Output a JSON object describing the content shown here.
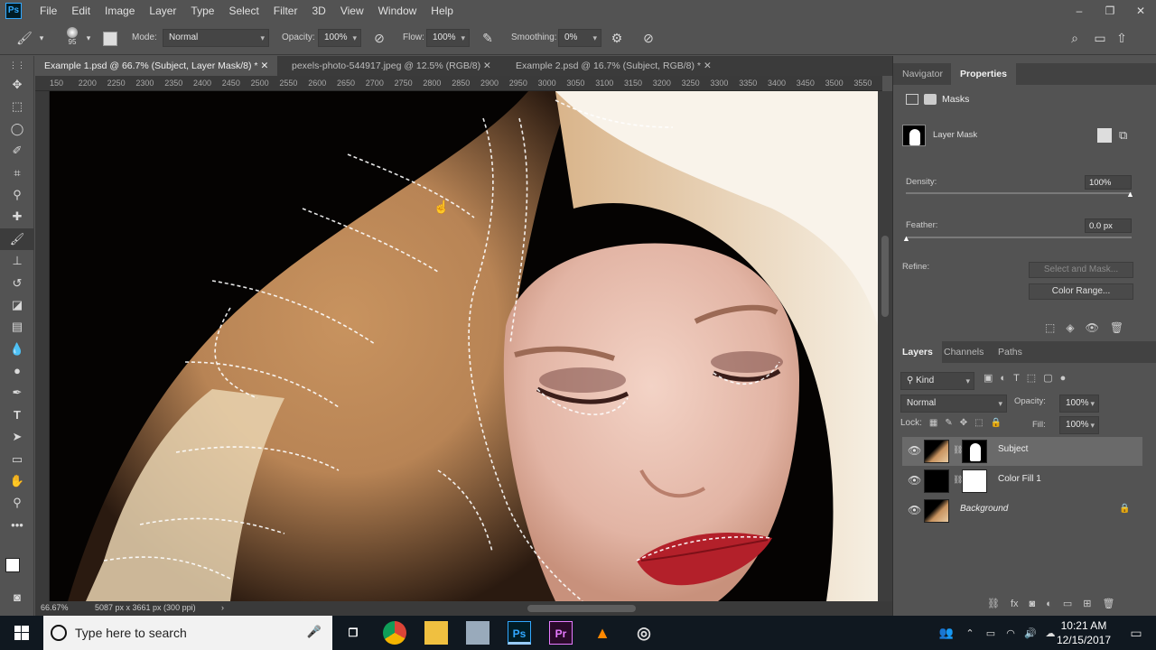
{
  "app": {
    "logo": "Ps"
  },
  "menu": [
    "File",
    "Edit",
    "Image",
    "Layer",
    "Type",
    "Select",
    "Filter",
    "3D",
    "View",
    "Window",
    "Help"
  ],
  "window_controls": [
    "–",
    "❐",
    "✕"
  ],
  "options": {
    "brush_size": "95",
    "mode_label": "Mode:",
    "mode_value": "Normal",
    "opacity_label": "Opacity:",
    "opacity_value": "100%",
    "flow_label": "Flow:",
    "flow_value": "100%",
    "smoothing_label": "Smoothing:",
    "smoothing_value": "0%"
  },
  "tabs": [
    {
      "label": "Example 1.psd @ 66.7% (Subject, Layer Mask/8) *"
    },
    {
      "label": "pexels-photo-544917.jpeg @ 12.5% (RGB/8)"
    },
    {
      "label": "Example 2.psd @ 16.7% (Subject, RGB/8) *"
    }
  ],
  "ruler_ticks": [
    "150",
    "2200",
    "2250",
    "2300",
    "2350",
    "2400",
    "2450",
    "2500",
    "2550",
    "2600",
    "2650",
    "2700",
    "2750",
    "2800",
    "2850",
    "2900",
    "2950",
    "3000",
    "3050",
    "3100",
    "3150",
    "3200",
    "3250",
    "3300",
    "3350",
    "3400",
    "3450",
    "3500",
    "3550",
    "3600"
  ],
  "status": {
    "zoom": "66.67%",
    "doc_info": "5087 px x 3661 px (300 ppi)"
  },
  "panels": {
    "top_tabs": [
      "Navigator",
      "Properties"
    ],
    "masks_title": "Masks",
    "layer_mask_label": "Layer Mask",
    "density_label": "Density:",
    "density_value": "100%",
    "density_level": 1.0,
    "feather_label": "Feather:",
    "feather_value": "0.0 px",
    "feather_level": 0.0,
    "refine_label": "Refine:",
    "select_mask_btn": "Select and Mask...",
    "color_range_btn": "Color Range...",
    "layers_tabs": [
      "Layers",
      "Channels",
      "Paths"
    ],
    "kind_label": "Kind",
    "blend_mode": "Normal",
    "opacity_label": "Opacity:",
    "opacity_value": "100%",
    "lock_label": "Lock:",
    "fill_label": "Fill:",
    "fill_value": "100%",
    "layers": [
      {
        "name": "Subject"
      },
      {
        "name": "Color Fill 1"
      },
      {
        "name": "Background"
      }
    ]
  },
  "taskbar": {
    "search_placeholder": "Type here to search",
    "apps": [
      "Ps",
      "Pr"
    ],
    "time": "10:21 AM",
    "date": "12/15/2017"
  }
}
